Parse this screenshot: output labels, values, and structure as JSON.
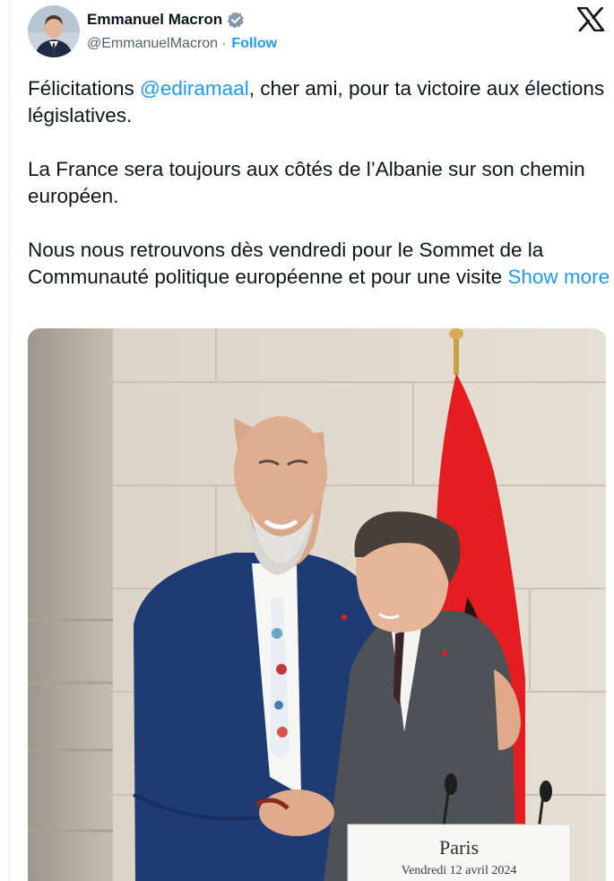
{
  "author": {
    "display_name": "Emmanuel Macron",
    "handle": "@EmmanuelMacron",
    "separator": "·",
    "follow_label": "Follow",
    "verified": true
  },
  "tweet": {
    "p1_before": "Félicitations ",
    "p1_mention": "@ediramaal",
    "p1_after": ", cher ami, pour ta victoire aux élections législatives.",
    "p2": "La France sera toujours aux côtés de l’Albanie sur son chemin européen.",
    "p3": "Nous nous retrouvons dès vendredi pour le Sommet de la Communauté politique européenne et pour une visite",
    "show_more": "Show more"
  },
  "photo": {
    "podium_title": "Paris",
    "podium_date": "Vendredi 12 avril 2024"
  },
  "colors": {
    "accent": "#1d9bf0",
    "text": "#0f1419",
    "secondary": "#536471",
    "flag_red": "#e41e20"
  },
  "icons": {
    "platform": "x-logo-icon",
    "verified": "verified-badge-icon"
  }
}
